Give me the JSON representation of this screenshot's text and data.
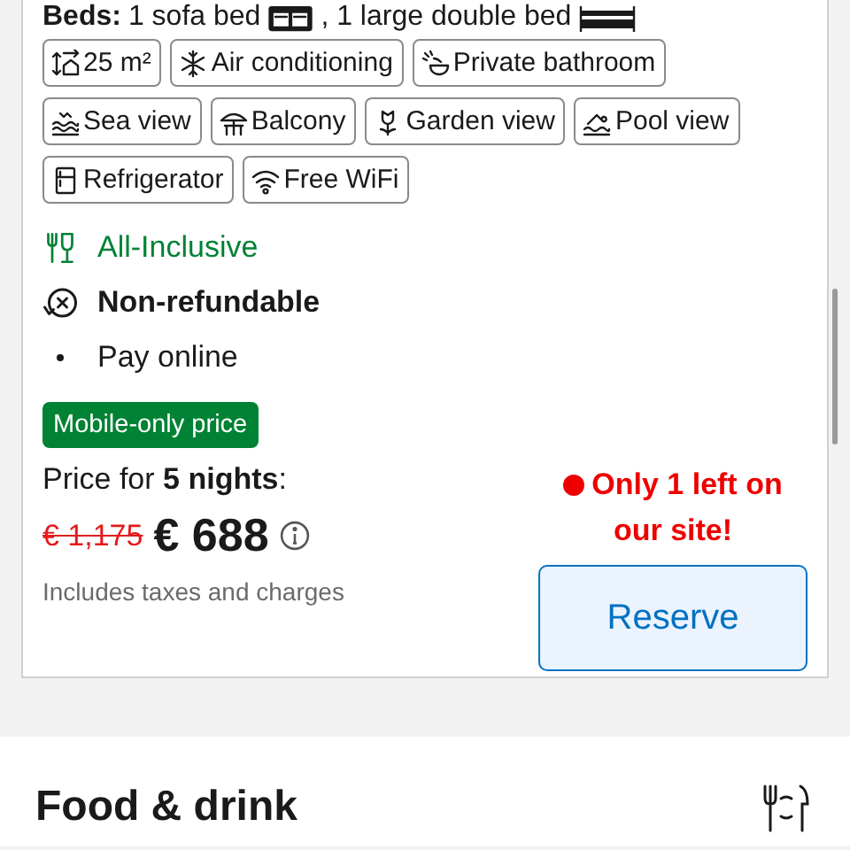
{
  "beds": {
    "label": "Beds:",
    "items": [
      {
        "kind": "sofa",
        "text": "1 sofa bed"
      },
      {
        "kind": "double",
        "text": ", 1 large double bed"
      }
    ]
  },
  "amenities": [
    {
      "kind": "area",
      "label": "25 m²"
    },
    {
      "kind": "snowflake",
      "label": "Air conditioning"
    },
    {
      "kind": "shower",
      "label": "Private bathroom"
    },
    {
      "kind": "waves",
      "label": "Sea view"
    },
    {
      "kind": "umbrella",
      "label": "Balcony"
    },
    {
      "kind": "flower",
      "label": "Garden view"
    },
    {
      "kind": "swimmer",
      "label": "Pool view"
    },
    {
      "kind": "fridge",
      "label": "Refrigerator"
    },
    {
      "kind": "wifi",
      "label": "Free WiFi"
    }
  ],
  "conditions": [
    {
      "kind": "meal",
      "text": "All-Inclusive"
    },
    {
      "kind": "policy",
      "text": "Non-refundable"
    },
    {
      "kind": "bullet",
      "text": "Pay online"
    }
  ],
  "badge": "Mobile-only price",
  "price": {
    "label": "Price for **5 nights**:",
    "old": "€ 1,175",
    "current": "€ 688",
    "note": "Includes taxes and charges"
  },
  "scarcity": "Only 1 left on our site!",
  "reserve_button": "Reserve",
  "section": {
    "title": "Food & drink"
  }
}
